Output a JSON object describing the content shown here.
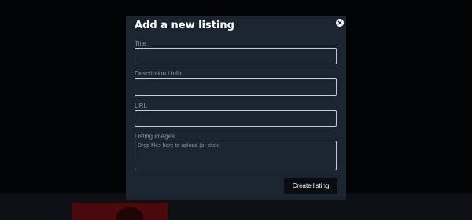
{
  "modal": {
    "title": "Add a new listing",
    "close_icon": "close-icon",
    "fields": {
      "title": {
        "label": "Title",
        "value": ""
      },
      "description": {
        "label": "Description / info",
        "value": ""
      },
      "url": {
        "label": "URL",
        "value": ""
      },
      "images": {
        "label": "Listing images",
        "dropzone_text": "Drop files here to upload (or click)"
      }
    },
    "submit_label": "Create listing"
  },
  "colors": {
    "page_background": "#020304",
    "modal_background": "#1a2530",
    "input_border": "#c5ccd2",
    "label_text": "#8c97a1",
    "button_background": "#0a0e12",
    "backdrop_thumbnail": "#4a0a0c"
  }
}
